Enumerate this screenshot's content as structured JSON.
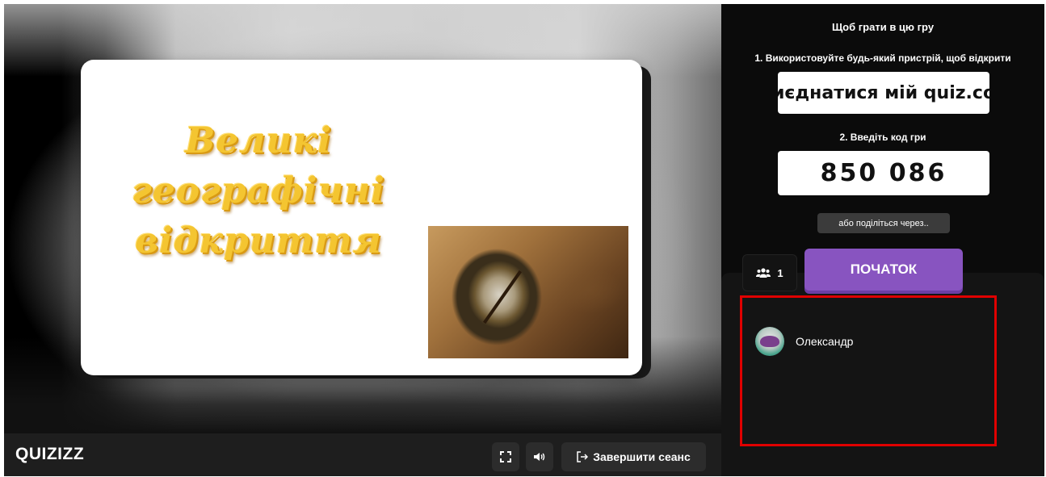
{
  "slide": {
    "title_lines": [
      "Великі",
      "географічні",
      "відкриття"
    ],
    "image": "compass-on-map-image"
  },
  "bottombar": {
    "logo": "QUIZIZZ",
    "fullscreen_icon": "fullscreen-icon",
    "sound_icon": "speaker-icon",
    "end_label": "Завершити сеанс",
    "end_icon": "exit-arrow-icon"
  },
  "join": {
    "heading": "Щоб грати в цю гру",
    "step1": "1. Використовуйте будь-який пристрій, щоб відкрити",
    "url": "иєднатися мій quiz.co",
    "step2": "2. Введіть код гри",
    "code": "850 086",
    "share_label": "або поділіться через.."
  },
  "lobby": {
    "player_count": "1",
    "count_icon": "users-icon",
    "start_label": "ПОЧАТОК",
    "players": [
      {
        "name": "Олександр"
      }
    ]
  },
  "colors": {
    "accent": "#8854c0",
    "highlight": "#e00000",
    "panel_bg": "#0b0b0b"
  }
}
